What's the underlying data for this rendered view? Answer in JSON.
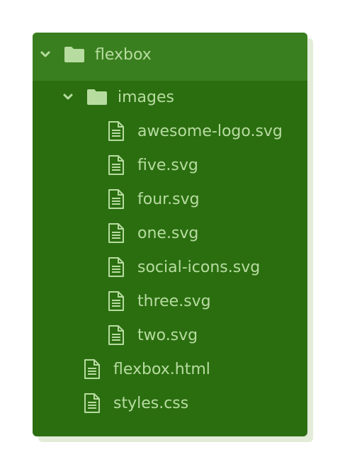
{
  "tree": {
    "root": {
      "label": "flexbox",
      "expanded": true,
      "icon": "folder-icon"
    },
    "images_folder": {
      "label": "images",
      "expanded": true,
      "icon": "folder-icon"
    },
    "image_files": [
      {
        "label": "awesome-logo.svg",
        "icon": "file-icon"
      },
      {
        "label": "five.svg",
        "icon": "file-icon"
      },
      {
        "label": "four.svg",
        "icon": "file-icon"
      },
      {
        "label": "one.svg",
        "icon": "file-icon"
      },
      {
        "label": "social-icons.svg",
        "icon": "file-icon"
      },
      {
        "label": "three.svg",
        "icon": "file-icon"
      },
      {
        "label": "two.svg",
        "icon": "file-icon"
      }
    ],
    "root_files": [
      {
        "label": "flexbox.html",
        "icon": "file-icon"
      },
      {
        "label": "styles.css",
        "icon": "file-icon"
      }
    ]
  },
  "colors": {
    "panel": "#2b6e10",
    "header": "#3a7f1f",
    "text": "#b7dca0",
    "shadow": "#e3ecd9"
  }
}
